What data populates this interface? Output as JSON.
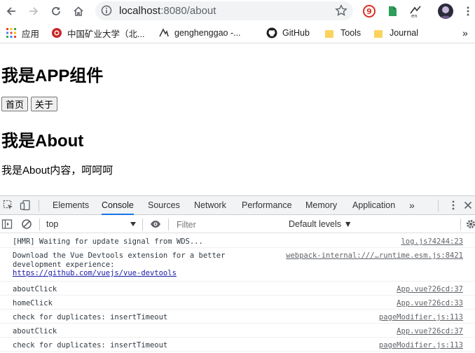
{
  "browser": {
    "url_host": "localhost",
    "url_port_path": ":8080/about",
    "bookmarks": [
      {
        "label": "应用",
        "icon": "apps-grid-icon"
      },
      {
        "label": "中国矿业大学（北...",
        "icon": "university-logo-icon"
      },
      {
        "label": "genghenggao -...",
        "icon": "profile-logo-icon"
      },
      {
        "label": "GitHub",
        "icon": "github-icon"
      },
      {
        "label": "Tools",
        "icon": "folder-icon"
      },
      {
        "label": "Journal",
        "icon": "folder-icon"
      }
    ],
    "more_bookmarks": "»"
  },
  "page": {
    "app_heading": "我是APP组件",
    "nav_buttons": [
      "首页",
      "关于"
    ],
    "about_heading": "我是About",
    "about_text": "我是About内容，呵呵呵"
  },
  "devtools": {
    "tabs": [
      "Elements",
      "Console",
      "Sources",
      "Network",
      "Performance",
      "Memory",
      "Application"
    ],
    "active_tab": "Console",
    "more_tabs": "»",
    "context": "top",
    "filter_placeholder": "Filter",
    "levels": "Default levels ▼",
    "messages": [
      {
        "text": "[HMR] Waiting for update signal from WDS...",
        "source": "log.js?4244:23"
      },
      {
        "text": "Download the Vue Devtools extension for a better\ndevelopment experience:",
        "link": "https://github.com/vuejs/vue-devtools",
        "source": "webpack-internal:///…runtime.esm.js:8421"
      },
      {
        "text": "aboutClick",
        "source": "App.vue?26cd:37"
      },
      {
        "text": "homeClick",
        "source": "App.vue?26cd:33"
      },
      {
        "text": "check for duplicates: insertTimeout",
        "source": "pageModifier.js:113"
      },
      {
        "text": "aboutClick",
        "source": "App.vue?26cd:37"
      },
      {
        "text": "check for duplicates: insertTimeout",
        "source": "pageModifier.js:113"
      }
    ]
  }
}
